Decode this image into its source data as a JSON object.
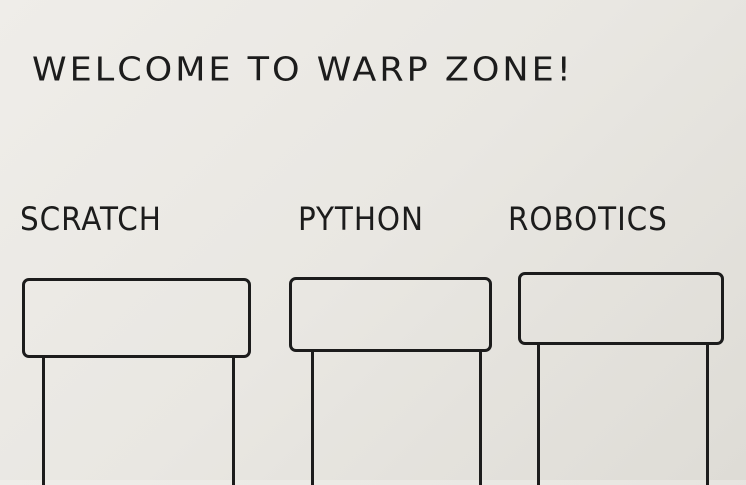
{
  "header": {
    "title": "WELCOME TO WARP ZONE!"
  },
  "pipes": [
    {
      "label": "SCRATCH"
    },
    {
      "label": "PYTHON"
    },
    {
      "label": "ROBOTICS"
    }
  ]
}
